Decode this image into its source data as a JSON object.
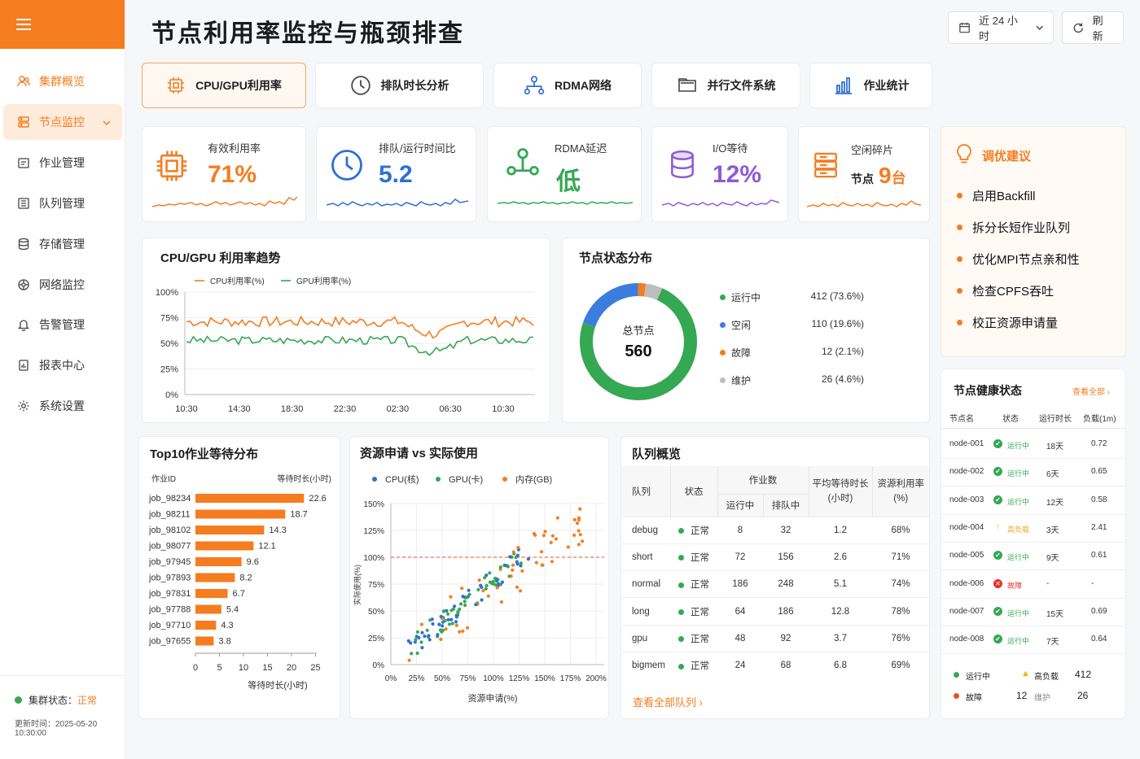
{
  "sidebar": {
    "items": [
      {
        "label": "集群概览",
        "icon": "users-icon"
      },
      {
        "label": "节点监控",
        "icon": "server-icon"
      },
      {
        "label": "作业管理",
        "icon": "briefcase-icon"
      },
      {
        "label": "队列管理",
        "icon": "list-icon"
      },
      {
        "label": "存储管理",
        "icon": "database-icon"
      },
      {
        "label": "网络监控",
        "icon": "network-icon"
      },
      {
        "label": "告警管理",
        "icon": "bell-icon"
      },
      {
        "label": "报表中心",
        "icon": "report-icon"
      },
      {
        "label": "系统设置",
        "icon": "gear-icon"
      }
    ],
    "status_label": "集群状态：",
    "status_value": "正常",
    "update_time": "更新时间：2025-05-20 10:30:00"
  },
  "header": {
    "title": "节点利用率监控与瓶颈排查",
    "time_range": "近 24 小时",
    "refresh": "刷新"
  },
  "tabs": [
    "CPU/GPU利用率",
    "排队时长分析",
    "RDMA网络",
    "并行文件系统",
    "作业统计"
  ],
  "kpis": [
    {
      "label": "有效利用率",
      "value": "71%",
      "color": "#f57c1f"
    },
    {
      "label": "排队/运行时间比",
      "value": "5.2",
      "color": "#2f6fd6"
    },
    {
      "label": "RDMA延迟",
      "value": "低",
      "color": "#34a853"
    },
    {
      "label": "I/O等待",
      "value": "12%",
      "color": "#8e5bd6"
    },
    {
      "label": "空闲碎片",
      "prefix": "节点",
      "value": "9",
      "suffix": "台",
      "color": "#f57c1f"
    }
  ],
  "advice": {
    "title": "调优建议",
    "items": [
      "启用Backfill",
      "拆分长短作业队列",
      "优化MPI节点亲和性",
      "检查CPFS吞吐",
      "校正资源申请量"
    ]
  },
  "trend": {
    "title": "CPU/GPU 利用率趋势",
    "legend": [
      "CPU利用率(%)",
      "GPU利用率(%)"
    ],
    "yticks": [
      "100%",
      "75%",
      "50%",
      "25%",
      "0%"
    ],
    "xticks": [
      "10:30",
      "14:30",
      "18:30",
      "22:30",
      "02:30",
      "06:30",
      "10:30"
    ],
    "colors": [
      "#f57c1f",
      "#34a853"
    ]
  },
  "node_status": {
    "title": "节点状态分布",
    "center_label": "总节点",
    "center_value": "560",
    "items": [
      {
        "label": "运行中",
        "value": "412 (73.6%)",
        "count": 412,
        "color": "#34a853"
      },
      {
        "label": "空闲",
        "value": "110 (19.6%)",
        "count": 110,
        "color": "#3b7ddd"
      },
      {
        "label": "故障",
        "value": "12 (2.1%)",
        "count": 12,
        "color": "#f57c1f"
      },
      {
        "label": "维护",
        "value": "26 (4.6%)",
        "count": 26,
        "color": "#bdbdbd"
      }
    ]
  },
  "top10": {
    "title": "Top10作业等待分布",
    "col_job": "作业ID",
    "col_wait": "等待时长(小时)",
    "xlabel": "等待时长(小时)",
    "xticks": [
      "0",
      "5",
      "10",
      "15",
      "20",
      "25"
    ],
    "jobs": [
      {
        "id": "job_98234",
        "value": 22.6
      },
      {
        "id": "job_98211",
        "value": 18.7
      },
      {
        "id": "job_98102",
        "value": 14.3
      },
      {
        "id": "job_98077",
        "value": 12.1
      },
      {
        "id": "job_97945",
        "value": 9.6
      },
      {
        "id": "job_97893",
        "value": 8.2
      },
      {
        "id": "job_97831",
        "value": 6.7
      },
      {
        "id": "job_97788",
        "value": 5.4
      },
      {
        "id": "job_97710",
        "value": 4.3
      },
      {
        "id": "job_97655",
        "value": 3.8
      }
    ]
  },
  "scatter": {
    "title": "资源申请  vs  实际使用",
    "legend": [
      "CPU(核)",
      "GPU(卡)",
      "内存(GB)"
    ],
    "colors": [
      "#2f6fd6",
      "#34a853",
      "#f57c1f"
    ],
    "yticks": [
      "150%",
      "125%",
      "100%",
      "75%",
      "50%",
      "25%",
      "0%"
    ],
    "xticks": [
      "0%",
      "25%",
      "50%",
      "75%",
      "100%",
      "125%",
      "150%",
      "175%",
      "200%"
    ],
    "xlabel": "资源申请(%)",
    "ylabel": "实际使用(%)"
  },
  "queues": {
    "title": "队列概览",
    "headers": {
      "queue": "队列",
      "status": "状态",
      "jobs": "作业数",
      "running": "运行中",
      "pending": "排队中",
      "avg_wait": "平均等待时长",
      "avg_wait_unit": "(小时)",
      "util": "资源利用率",
      "util_unit": "(%)"
    },
    "rows": [
      {
        "name": "debug",
        "status": "正常",
        "running": "8",
        "pending": "32",
        "wait": "1.2",
        "util": "68%"
      },
      {
        "name": "short",
        "status": "正常",
        "running": "72",
        "pending": "156",
        "wait": "2.6",
        "util": "71%"
      },
      {
        "name": "normal",
        "status": "正常",
        "running": "186",
        "pending": "248",
        "wait": "5.1",
        "util": "74%"
      },
      {
        "name": "long",
        "status": "正常",
        "running": "64",
        "pending": "186",
        "wait": "12.8",
        "util": "78%"
      },
      {
        "name": "gpu",
        "status": "正常",
        "running": "48",
        "pending": "92",
        "wait": "3.7",
        "util": "76%"
      },
      {
        "name": "bigmem",
        "status": "正常",
        "running": "24",
        "pending": "68",
        "wait": "6.8",
        "util": "69%"
      }
    ],
    "view_all": "查看全部队列 ›"
  },
  "health": {
    "title": "节点健康状态",
    "view_all": "查看全部 ›",
    "headers": [
      "节点名",
      "状态",
      "运行时长",
      "负载(1m)"
    ],
    "rows": [
      {
        "node": "node-001",
        "status": "运行中",
        "kind": "ok",
        "uptime": "18天",
        "load": "0.72"
      },
      {
        "node": "node-002",
        "status": "运行中",
        "kind": "ok",
        "uptime": "6天",
        "load": "0.65"
      },
      {
        "node": "node-003",
        "status": "运行中",
        "kind": "ok",
        "uptime": "12天",
        "load": "0.58"
      },
      {
        "node": "node-004",
        "status": "高负载",
        "kind": "warn",
        "uptime": "3天",
        "load": "2.41"
      },
      {
        "node": "node-005",
        "status": "运行中",
        "kind": "ok",
        "uptime": "9天",
        "load": "0.61"
      },
      {
        "node": "node-006",
        "status": "故障",
        "kind": "err",
        "uptime": "-",
        "load": "-"
      },
      {
        "node": "node-007",
        "status": "运行中",
        "kind": "ok",
        "uptime": "15天",
        "load": "0.69"
      },
      {
        "node": "node-008",
        "status": "运行中",
        "kind": "ok",
        "uptime": "7天",
        "load": "0.64"
      }
    ],
    "summary": {
      "running_label": "运行中",
      "running_value": "412",
      "high_label": "高负载",
      "fault_label": "故障",
      "fault_value": "12",
      "maint_label": "维护",
      "maint_value": "26"
    }
  }
}
